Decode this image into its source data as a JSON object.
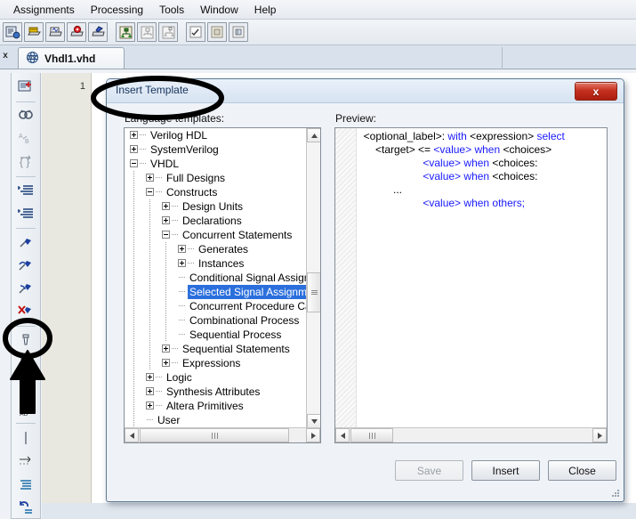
{
  "menubar": {
    "items": [
      {
        "label": "Assignments"
      },
      {
        "label": "Processing"
      },
      {
        "label": "Tools"
      },
      {
        "label": "Window"
      },
      {
        "label": "Help"
      }
    ]
  },
  "toolbar": {
    "icons": [
      "compile-design-icon",
      "start-compilation-icon",
      "analysis-synthesis-icon",
      "fitter-icon",
      "assembler-icon",
      "rtl-viewer-icon",
      "technology-map-viewer-icon",
      "state-machine-viewer-icon",
      "pin-planner-icon",
      "settings-icon",
      "programmer-icon"
    ]
  },
  "document_tab": {
    "label": "Vhdl1.vhd",
    "icon": "abc-globe-icon",
    "close_marker": "x"
  },
  "editor": {
    "line_number": "1"
  },
  "left_toolbar": {
    "icons": [
      "insert-file-icon",
      "find-icon",
      "replace-icon",
      "goto-icon",
      "increase-indent-icon",
      "decrease-indent-icon",
      "toggle-bookmark-icon",
      "next-bookmark-icon",
      "previous-bookmark-icon",
      "clear-bookmarks-icon",
      "comment-icon",
      "insert-template-icon",
      "lowercase-icon",
      "uppercase-icon",
      "divider-icon",
      "arrow-icon",
      "indent-lines-icon",
      "undo-icon"
    ]
  },
  "dialog": {
    "title": "Insert Template",
    "close_button": "x",
    "labels": {
      "language_templates": "Language templates:",
      "preview": "Preview:"
    },
    "tree": [
      {
        "label": "Verilog HDL",
        "depth": 0,
        "state": "collapsed",
        "selected": false
      },
      {
        "label": "SystemVerilog",
        "depth": 0,
        "state": "collapsed",
        "selected": false
      },
      {
        "label": "VHDL",
        "depth": 0,
        "state": "expanded",
        "selected": false
      },
      {
        "label": "Full Designs",
        "depth": 1,
        "state": "collapsed",
        "selected": false
      },
      {
        "label": "Constructs",
        "depth": 1,
        "state": "expanded",
        "selected": false
      },
      {
        "label": "Design Units",
        "depth": 2,
        "state": "collapsed",
        "selected": false
      },
      {
        "label": "Declarations",
        "depth": 2,
        "state": "collapsed",
        "selected": false
      },
      {
        "label": "Concurrent Statements",
        "depth": 2,
        "state": "expanded",
        "selected": false
      },
      {
        "label": "Generates",
        "depth": 3,
        "state": "collapsed",
        "selected": false
      },
      {
        "label": "Instances",
        "depth": 3,
        "state": "collapsed",
        "selected": false
      },
      {
        "label": "Conditional Signal Assignm",
        "depth": 3,
        "state": "leaf",
        "selected": false
      },
      {
        "label": "Selected Signal Assignmen",
        "depth": 3,
        "state": "leaf",
        "selected": true
      },
      {
        "label": "Concurrent Procedure Call",
        "depth": 3,
        "state": "leaf",
        "selected": false
      },
      {
        "label": "Combinational Process",
        "depth": 3,
        "state": "leaf",
        "selected": false
      },
      {
        "label": "Sequential Process",
        "depth": 3,
        "state": "leaf",
        "selected": false
      },
      {
        "label": "Sequential Statements",
        "depth": 2,
        "state": "collapsed",
        "selected": false
      },
      {
        "label": "Expressions",
        "depth": 2,
        "state": "collapsed",
        "selected": false
      },
      {
        "label": "Logic",
        "depth": 1,
        "state": "collapsed",
        "selected": false
      },
      {
        "label": "Synthesis Attributes",
        "depth": 1,
        "state": "collapsed",
        "selected": false
      },
      {
        "label": "Altera Primitives",
        "depth": 1,
        "state": "collapsed",
        "selected": false
      },
      {
        "label": "User",
        "depth": 1,
        "state": "leaf",
        "selected": false
      }
    ],
    "preview_code": [
      [
        {
          "t": "  <optional_label>: ",
          "c": "ph"
        },
        {
          "t": "with",
          "c": "kw"
        },
        {
          "t": " <expression> ",
          "c": "ph"
        },
        {
          "t": "select",
          "c": "kw"
        }
      ],
      [
        {
          "t": "      <target> <= ",
          "c": "ph"
        },
        {
          "t": "<value>",
          "c": "kw"
        },
        {
          "t": " ",
          "c": "ph"
        },
        {
          "t": "when",
          "c": "kw"
        },
        {
          "t": " <choices>",
          "c": "ph"
        }
      ],
      [
        {
          "t": "                      ",
          "c": "ph"
        },
        {
          "t": "<value>",
          "c": "kw"
        },
        {
          "t": " ",
          "c": "ph"
        },
        {
          "t": "when",
          "c": "kw"
        },
        {
          "t": " <choices:",
          "c": "ph"
        }
      ],
      [
        {
          "t": "                      ",
          "c": "ph"
        },
        {
          "t": "<value>",
          "c": "kw"
        },
        {
          "t": " ",
          "c": "ph"
        },
        {
          "t": "when",
          "c": "kw"
        },
        {
          "t": " <choices:",
          "c": "ph"
        }
      ],
      [
        {
          "t": "            ...",
          "c": "ph"
        }
      ],
      [
        {
          "t": "                      ",
          "c": "ph"
        },
        {
          "t": "<value>",
          "c": "kw"
        },
        {
          "t": " ",
          "c": "ph"
        },
        {
          "t": "when others;",
          "c": "kw"
        }
      ]
    ],
    "buttons": {
      "save": "Save",
      "save_enabled": false,
      "insert": "Insert",
      "insert_enabled": true,
      "close": "Close",
      "close_enabled": true
    }
  },
  "annotations": {
    "title_ellipse": "black-ellipse-around-insert-template",
    "icon_ellipse": "black-ellipse-around-template-toolbar-icon",
    "arrow": "black-up-arrow-pointing-at-template-icon"
  },
  "colors": {
    "selection_blue": "#2b6fdd",
    "keyword_blue": "#1a1aff",
    "close_red": "#c6301f",
    "dialog_bg": "#eff3f8",
    "annotation_black": "#000000"
  }
}
